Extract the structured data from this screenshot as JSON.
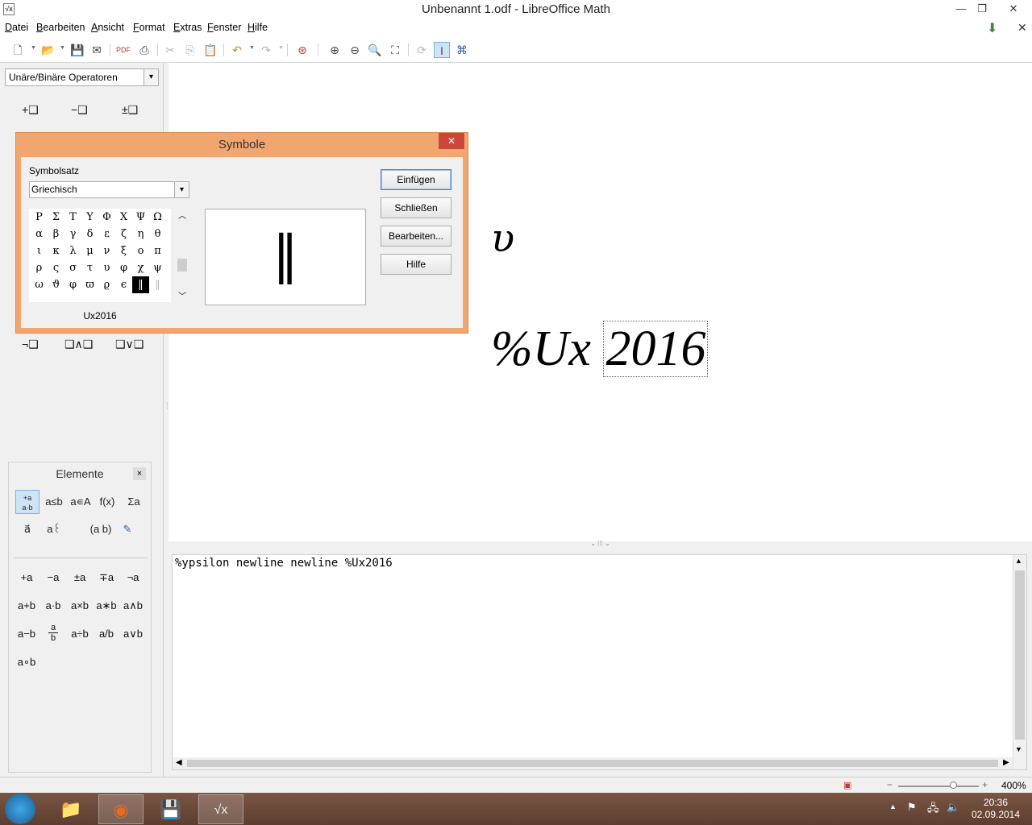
{
  "window": {
    "title": "Unbenannt 1.odf - LibreOffice Math",
    "app_icon": "√x"
  },
  "menu": [
    "Datei",
    "Bearbeiten",
    "Ansicht",
    "Format",
    "Extras",
    "Fenster",
    "Hilfe"
  ],
  "left_panel": {
    "category": "Unäre/Binäre Operatoren",
    "ops_top": [
      "+❑",
      "−❑",
      "±❑"
    ],
    "ops_bottom": [
      "¬❑",
      "❑∧❑",
      "❑∨❑"
    ]
  },
  "elements_panel": {
    "title": "Elemente",
    "close": "×",
    "category_icons": [
      "+a/a·b",
      "a≤b",
      "a∊A",
      "f(x)",
      "Σa",
      "a⃗",
      "a꒰",
      "(a b)",
      "✎"
    ],
    "operators": [
      "+a",
      "−a",
      "±a",
      "∓a",
      "¬a",
      "a+b",
      "a·b",
      "a×b",
      "a∗b",
      "a∧b",
      "a−b",
      "a/b frac",
      "a÷b",
      "a/b",
      "a∨b",
      "a∘b"
    ],
    "frac": {
      "num": "a",
      "den": "b"
    }
  },
  "symbols_dialog": {
    "title": "Symbole",
    "symbolset_label": "Symbolsatz",
    "symbolset_value": "Griechisch",
    "grid": [
      [
        "Ρ",
        "Σ",
        "Τ",
        "Υ",
        "Φ",
        "Χ",
        "Ψ",
        "Ω"
      ],
      [
        "α",
        "β",
        "γ",
        "δ",
        "ε",
        "ζ",
        "η",
        "θ"
      ],
      [
        "ι",
        "κ",
        "λ",
        "μ",
        "ν",
        "ξ",
        "ο",
        "π"
      ],
      [
        "ρ",
        "ς",
        "σ",
        "τ",
        "υ",
        "φ",
        "χ",
        "ψ"
      ],
      [
        "ω",
        "ϑ",
        "φ",
        "ϖ",
        "ϱ",
        "ϵ",
        "‖",
        "‖"
      ]
    ],
    "selected_name": "Ux2016",
    "preview_char": "‖",
    "buttons": {
      "insert": "Einfügen",
      "close": "Schließen",
      "edit": "Bearbeiten...",
      "help": "Hilfe"
    }
  },
  "formula_view": {
    "line1": "υ",
    "line2_prefix": "%Ux",
    "line2_boxed": "2016"
  },
  "editor": {
    "text": "%ypsilon newline newline %Ux2016"
  },
  "statusbar": {
    "zoom": "400%"
  },
  "taskbar": {
    "time": "20:36",
    "date": "02.09.2014"
  }
}
